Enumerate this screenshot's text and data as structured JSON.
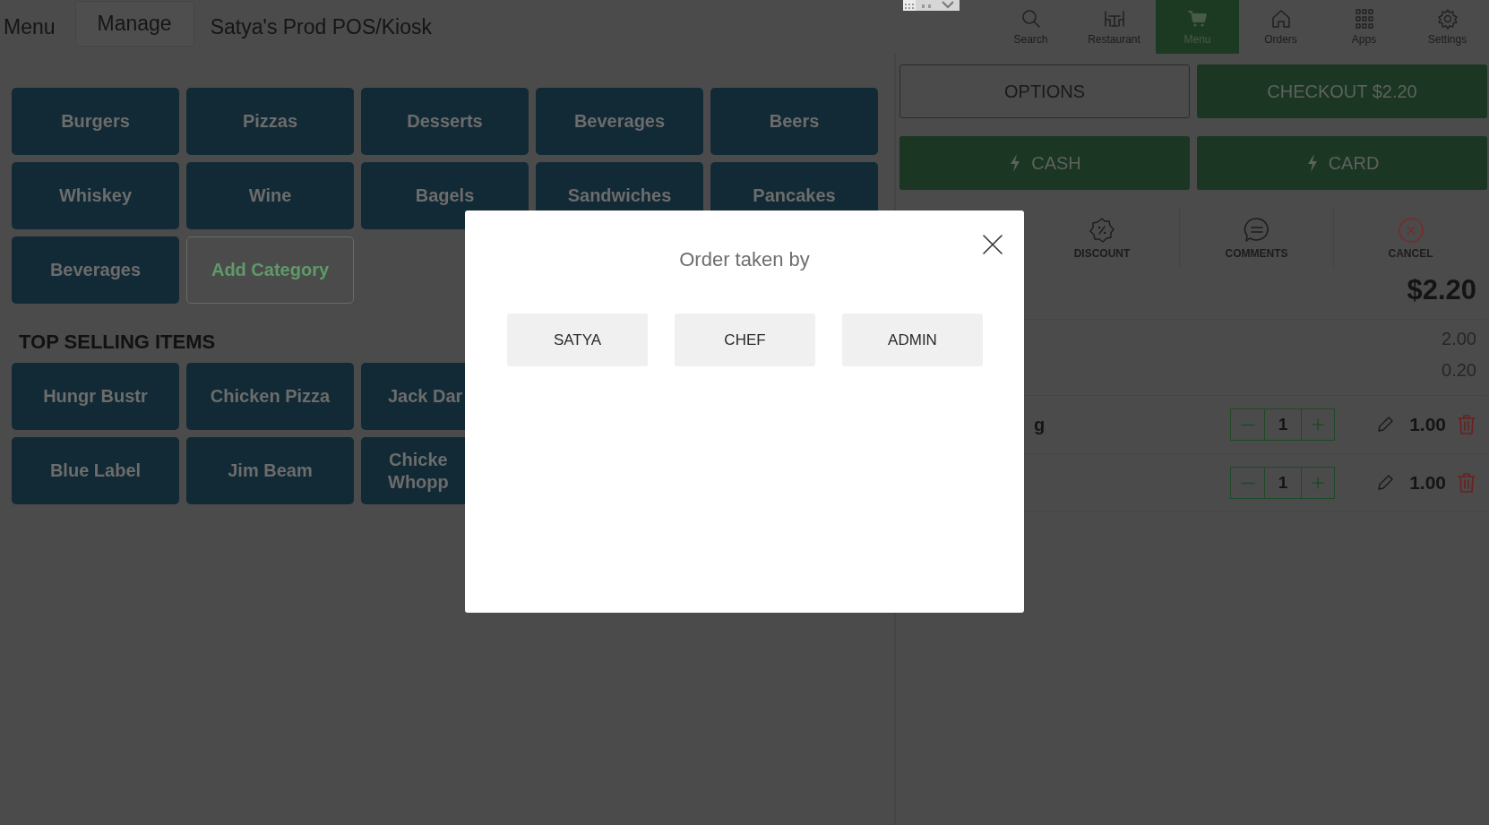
{
  "top_bar": {
    "tabs": [
      {
        "label": "Menu",
        "selected": false
      },
      {
        "label": "Manage",
        "selected": true
      }
    ],
    "title": "Satya's Prod POS/Kiosk",
    "nav": [
      {
        "label": "Search",
        "kind": "search",
        "selected": false
      },
      {
        "label": "Restaurant",
        "kind": "restaurant",
        "selected": false
      },
      {
        "label": "Menu",
        "kind": "cart",
        "selected": true
      },
      {
        "label": "Orders",
        "kind": "home",
        "selected": false
      },
      {
        "label": "Apps",
        "kind": "grid",
        "selected": false
      },
      {
        "label": "Settings",
        "kind": "gear",
        "selected": false
      }
    ]
  },
  "categories": [
    {
      "label": "Burgers",
      "kind": "category"
    },
    {
      "label": "Pizzas",
      "kind": "category"
    },
    {
      "label": "Desserts",
      "kind": "category"
    },
    {
      "label": "Beverages",
      "kind": "category"
    },
    {
      "label": "Beers",
      "kind": "category"
    },
    {
      "label": "Whiskey",
      "kind": "category"
    },
    {
      "label": "Wine",
      "kind": "category"
    },
    {
      "label": "Bagels",
      "kind": "category"
    },
    {
      "label": "Sandwiches",
      "kind": "category"
    },
    {
      "label": "Pancakes",
      "kind": "category"
    },
    {
      "label": "Beverages",
      "kind": "category"
    },
    {
      "label": "Add Category",
      "kind": "add"
    }
  ],
  "top_selling": {
    "heading": "TOP SELLING ITEMS",
    "items": [
      [
        "Hungr Bustr"
      ],
      [
        "Chicken Pizza"
      ],
      [
        "Jack Dar"
      ],
      [
        "Blue Label"
      ],
      [
        "Jim Beam"
      ],
      [
        "Chicke",
        "Whopp"
      ]
    ]
  },
  "order_panel": {
    "buttons": [
      {
        "label": "OPTIONS",
        "kind": "outline"
      },
      {
        "label": "CHECKOUT $2.20",
        "kind": "primary"
      },
      {
        "label": "CASH",
        "kind": "pay"
      },
      {
        "label": "CARD",
        "kind": "pay"
      }
    ],
    "actions": [
      {
        "label": "DISCOUNT",
        "kind": "discount"
      },
      {
        "label": "COMMENTS",
        "kind": "comments"
      },
      {
        "label": "CANCEL",
        "kind": "cancel"
      }
    ],
    "total": "$2.20",
    "amounts": [
      "2.00",
      "0.20"
    ],
    "items": [
      {
        "name": "g",
        "quantity": "1",
        "price": "1.00"
      },
      {
        "quantity": "1",
        "price": "1.00"
      }
    ]
  },
  "dialog": {
    "title": "Order taken by",
    "options": [
      "SATYA",
      "CHEF",
      "ADMIN"
    ]
  }
}
